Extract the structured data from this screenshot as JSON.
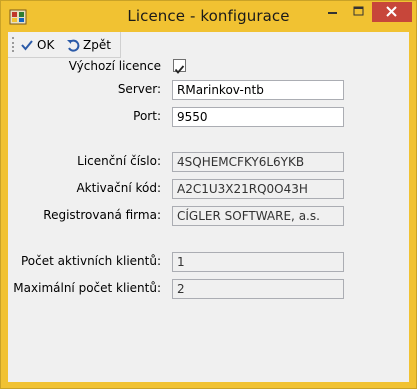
{
  "window": {
    "title": "Licence - konfigurace"
  },
  "toolbar": {
    "ok_label": "OK",
    "back_label": "Zpět"
  },
  "form": {
    "default_licence_label": "Výchozí licence",
    "default_licence_checked": true,
    "server_label": "Server:",
    "server_value": "RMarinkov-ntb",
    "port_label": "Port:",
    "port_value": "9550",
    "licence_number_label": "Licenční číslo:",
    "licence_number_value": "4SQHEMCFKY6L6YKB",
    "activation_code_label": "Aktivační kód:",
    "activation_code_value": "A2C1U3X21RQ0O43H",
    "registered_company_label": "Registrovaná firma:",
    "registered_company_value": "CÍGLER SOFTWARE, a.s.",
    "active_clients_label": "Počet aktivních klientů:",
    "active_clients_value": "1",
    "max_clients_label": "Maximální počet klientů:",
    "max_clients_value": "2"
  },
  "colors": {
    "frame": "#f1c232",
    "close_button": "#c7463a",
    "client_bg": "#f0f0f0"
  }
}
